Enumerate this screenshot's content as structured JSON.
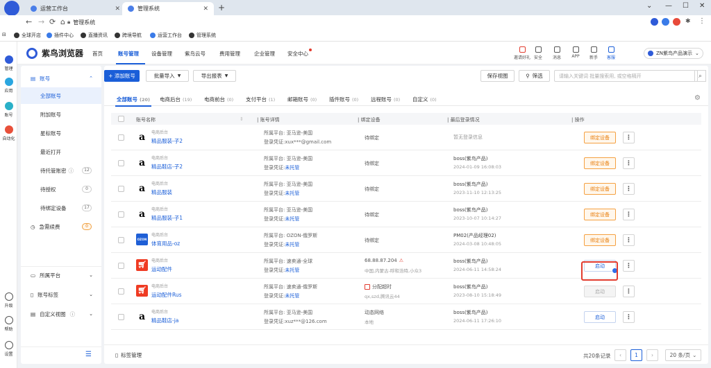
{
  "browser": {
    "tabs": [
      {
        "label": "运营工作台",
        "active": false
      },
      {
        "label": "管理系统",
        "active": true
      }
    ],
    "address": "管理系统",
    "bookmarks": [
      "全球开店",
      "插件中心",
      "直播资讯",
      "跨境导航",
      "运营工作台",
      "管理系统"
    ]
  },
  "rail": [
    {
      "label": "管理",
      "color": "#2f5bd8"
    },
    {
      "label": "应用",
      "color": "#2aa6e0"
    },
    {
      "label": "账号",
      "color": "#2ab0c8"
    },
    {
      "label": "自动化",
      "color": "#e8503a"
    }
  ],
  "rail_bottom": [
    "升级",
    "帮助",
    "设置"
  ],
  "header": {
    "brand": "紫鸟浏览器",
    "nav": [
      "首页",
      "账号管理",
      "设备管理",
      "紫鸟云号",
      "费用管理",
      "企业管理",
      "安全中心"
    ],
    "active_nav": 1,
    "icons": [
      {
        "label": "邀请好礼",
        "name": "gift-icon"
      },
      {
        "label": "安全",
        "name": "shield-icon"
      },
      {
        "label": "消息",
        "name": "bell-icon"
      },
      {
        "label": "APP",
        "name": "phone-icon"
      },
      {
        "label": "新手",
        "name": "trophy-icon"
      },
      {
        "label": "客服",
        "name": "headset-icon"
      }
    ],
    "user": "ZN紫鸟产品演示"
  },
  "sidebar": {
    "group": "账号",
    "items": [
      {
        "label": "全部账号",
        "count": null,
        "selected": true
      },
      {
        "label": "附加账号",
        "count": null
      },
      {
        "label": "星标账号",
        "count": null
      },
      {
        "label": "最近打开",
        "count": null
      },
      {
        "label": "待托管账密",
        "count": "12",
        "help": true
      },
      {
        "label": "待授权",
        "count": "0"
      },
      {
        "label": "待绑定设备",
        "count": "17"
      }
    ],
    "urgent": {
      "label": "急需续费",
      "count": "0"
    },
    "groups": [
      {
        "label": "所属平台",
        "name": "platform-group"
      },
      {
        "label": "账号标签",
        "name": "tags-group"
      },
      {
        "label": "自定义视图",
        "name": "custom-view-group",
        "help": true
      }
    ]
  },
  "toolbar": {
    "add": "+ 添加账号",
    "import": "批量导入",
    "export": "导出报表",
    "save_view": "保存视图",
    "filter": "筛选",
    "search_placeholder": "请输入关键词 批量搜索用, 或空格隔开"
  },
  "subtabs": [
    {
      "label": "全部账号",
      "count": "(20)"
    },
    {
      "label": "电商后台",
      "count": "(19)"
    },
    {
      "label": "电商前台",
      "count": "(0)"
    },
    {
      "label": "支付平台",
      "count": "(1)"
    },
    {
      "label": "邮箱账号",
      "count": "(0)"
    },
    {
      "label": "插件账号",
      "count": "(0)"
    },
    {
      "label": "远程账号",
      "count": "(0)"
    },
    {
      "label": "自定义",
      "count": "(0)"
    }
  ],
  "columns": [
    "账号名称",
    "账号详情",
    "绑定设备",
    "最后登录情况",
    "操作"
  ],
  "rows": [
    {
      "avatar": "amazon",
      "type": "电商后台",
      "name": "精品服装-子2",
      "platform": "所属平台: 亚马逊-美国",
      "cred_label": "登录凭证:",
      "cred": "xux***@gmail.com",
      "cred_link": false,
      "device": "待绑定",
      "device2": "",
      "login1": "暂无登录信息",
      "login2": "",
      "action": "绑定设备",
      "action_type": "bind"
    },
    {
      "avatar": "amazon",
      "type": "电商后台",
      "name": "精品鞋店-子2",
      "platform": "所属平台: 亚马逊-美国",
      "cred_label": "登录凭证:",
      "cred": "未托管",
      "cred_link": true,
      "device": "待绑定",
      "device2": "",
      "login1": "boss(紫鸟产品)",
      "login2": "2024-01-09 16:08:03",
      "action": "绑定设备",
      "action_type": "bind"
    },
    {
      "avatar": "amazon",
      "type": "电商后台",
      "name": "精品服装",
      "platform": "所属平台: 亚马逊-美国",
      "cred_label": "登录凭证:",
      "cred": "未托管",
      "cred_link": true,
      "device": "待绑定",
      "device2": "",
      "login1": "boss(紫鸟产品)",
      "login2": "2023-11-10 12:13:25",
      "action": "绑定设备",
      "action_type": "bind"
    },
    {
      "avatar": "amazon",
      "type": "电商后台",
      "name": "精品服装-子1",
      "platform": "所属平台: 亚马逊-美国",
      "cred_label": "登录凭证:",
      "cred": "未托管",
      "cred_link": true,
      "device": "待绑定",
      "device2": "",
      "login1": "boss(紫鸟产品)",
      "login2": "2023-10-07 10:14:27",
      "action": "绑定设备",
      "action_type": "bind"
    },
    {
      "avatar": "ozon",
      "type": "电商后台",
      "name": "体育用品-oz",
      "platform": "所属平台: OZON-俄罗斯",
      "cred_label": "登录凭证:",
      "cred": "未托管",
      "cred_link": true,
      "device": "待绑定",
      "device2": "",
      "login1": "PM02(产品经理02)",
      "login2": "2024-03-08 10:48:05",
      "action": "绑定设备",
      "action_type": "bind"
    },
    {
      "avatar": "ali",
      "type": "电商后台",
      "name": "运动配件",
      "platform": "所属平台: 速卖通-全球",
      "cred_label": "登录凭证:",
      "cred": "未托管",
      "cred_link": true,
      "device": "68.88.87.204",
      "device_warn": true,
      "device2": "中国,内蒙古-呼和浩特,小众3",
      "login1": "boss(紫鸟产品)",
      "login2": "2024-06-11 14:58:24",
      "action": "启动",
      "action_type": "start"
    },
    {
      "avatar": "ali",
      "type": "电商后台",
      "name": "运动配件Rus",
      "platform": "所属平台: 速卖通-俄罗斯",
      "cred_label": "登录凭证:",
      "cred": "未托管",
      "cred_link": true,
      "device": "分配超时",
      "device_tag": true,
      "device2": "qx,szd,腾讯云44",
      "login1": "boss(紫鸟产品)",
      "login2": "2023-08-10 15:18:49",
      "action": "启动",
      "action_type": "disabled"
    },
    {
      "avatar": "amazon",
      "type": "电商后台",
      "name": "精品鞋店-ja",
      "platform": "所属平台: 亚马逊-美国",
      "cred_label": "登录凭证:",
      "cred": "xuz***@126.com",
      "cred_link": false,
      "device": "动态网络",
      "device2": "本地",
      "login1": "boss(紫鸟产品)",
      "login2": "2024-06-11 17:26:10",
      "action": "启动",
      "action_type": "start"
    }
  ],
  "footer": {
    "tag_manage": "标签管理",
    "total": "共20条记录",
    "page": "1",
    "page_size": "20 条/页"
  }
}
